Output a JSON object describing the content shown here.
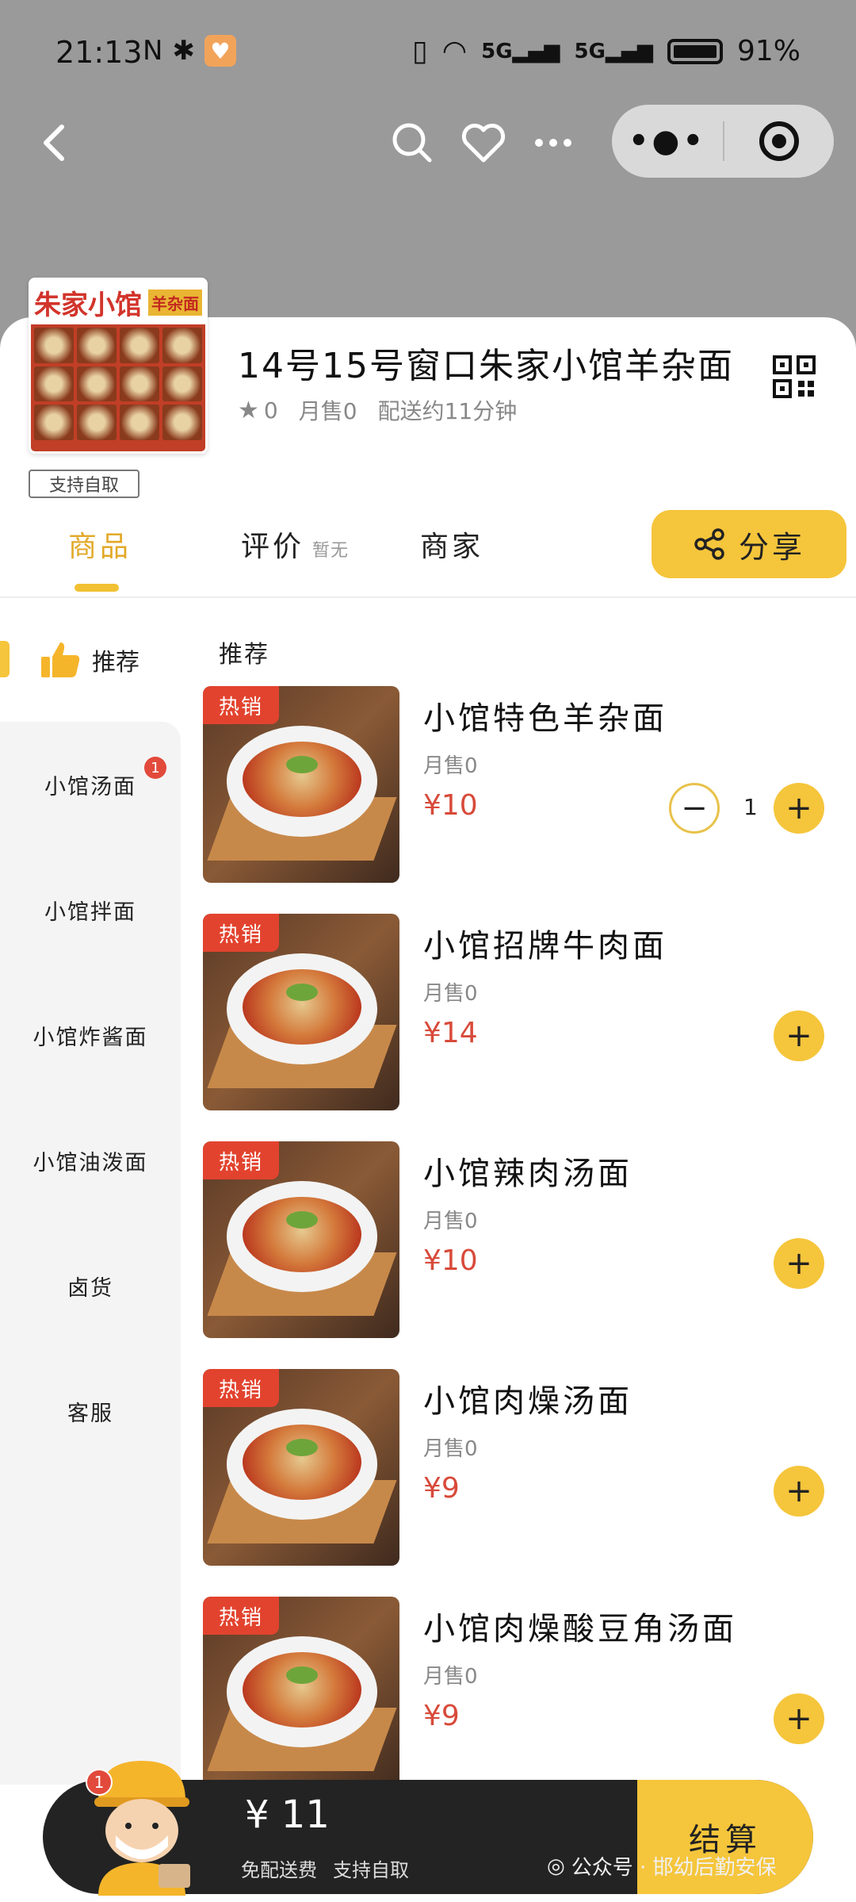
{
  "status_bar": {
    "time": "21:13",
    "signal_1": "5G",
    "signal_2": "5G",
    "battery": "91%"
  },
  "store": {
    "logo_name": "朱家小馆",
    "logo_tag": "羊杂面",
    "pickup_tag": "支持自取",
    "name": "14号15号窗口朱家小馆羊杂面",
    "rating": "0",
    "monthly_sales": "月售0",
    "delivery": "配送约11分钟"
  },
  "tabs": {
    "goods": "商品",
    "reviews": "评价",
    "reviews_sub": "暂无",
    "merchant": "商家",
    "share": "分享"
  },
  "sidebar": {
    "recommended": "推荐",
    "items": [
      {
        "label": "小馆汤面",
        "badge": "1"
      },
      {
        "label": "小馆拌面"
      },
      {
        "label": "小馆炸酱面"
      },
      {
        "label": "小馆油泼面"
      },
      {
        "label": "卤货"
      },
      {
        "label": "客服"
      }
    ]
  },
  "section_title": "推荐",
  "products": [
    {
      "tag": "热销",
      "name": "小馆特色羊杂面",
      "sold": "月售0",
      "price": "¥10",
      "qty": "1"
    },
    {
      "tag": "热销",
      "name": "小馆招牌牛肉面",
      "sold": "月售0",
      "price": "¥14"
    },
    {
      "tag": "热销",
      "name": "小馆辣肉汤面",
      "sold": "月售0",
      "price": "¥10"
    },
    {
      "tag": "热销",
      "name": "小馆肉燥汤面",
      "sold": "月售0",
      "price": "¥9"
    },
    {
      "tag": "热销",
      "name": "小馆肉燥酸豆角汤面",
      "sold": "月售0",
      "price": "¥9"
    }
  ],
  "cart": {
    "badge": "1",
    "total": "¥ 11",
    "free_delivery": "免配送费",
    "pickup": "支持自取",
    "checkout": "结算"
  },
  "watermark": "公众号 · 邯幼后勤安保",
  "colors": {
    "accent": "#f5c53b",
    "price": "#d84a3a",
    "hot_tag": "#e2432e",
    "badge": "#e24a3b"
  }
}
